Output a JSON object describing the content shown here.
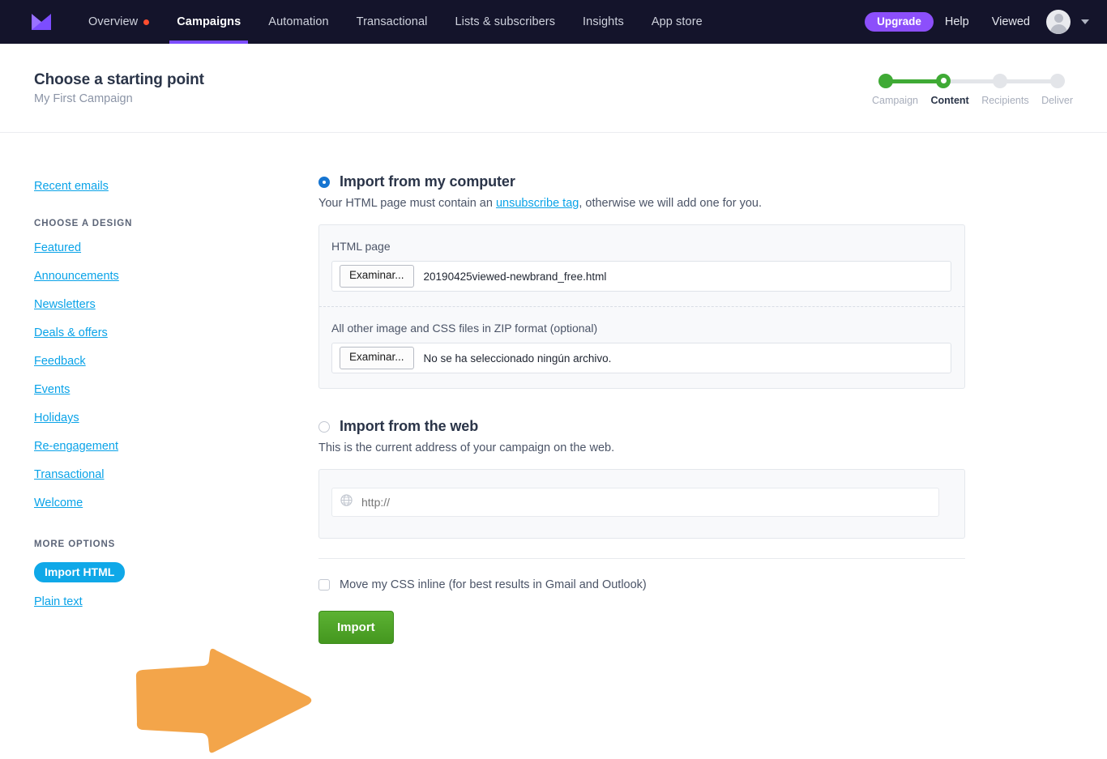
{
  "navbar": {
    "logo_name": "mailjet-logo",
    "links": [
      {
        "label": "Overview",
        "active": false,
        "dot": true
      },
      {
        "label": "Campaigns",
        "active": true,
        "dot": false
      },
      {
        "label": "Automation",
        "active": false,
        "dot": false
      },
      {
        "label": "Transactional",
        "active": false,
        "dot": false
      },
      {
        "label": "Lists & subscribers",
        "active": false,
        "dot": false
      },
      {
        "label": "Insights",
        "active": false,
        "dot": false
      },
      {
        "label": "App store",
        "active": false,
        "dot": false
      }
    ],
    "upgrade_label": "Upgrade",
    "help_label": "Help",
    "account_label": "Viewed",
    "accent_purple": "#7c4dff",
    "bar_color": "#14142b",
    "dot_color": "#ff4d2e"
  },
  "header": {
    "title": "Choose a starting point",
    "subtitle": "My First Campaign",
    "stepper": {
      "steps": [
        {
          "label": "Campaign",
          "state": "done"
        },
        {
          "label": "Content",
          "state": "current"
        },
        {
          "label": "Recipients",
          "state": "todo"
        },
        {
          "label": "Deliver",
          "state": "todo"
        }
      ],
      "done_color": "#3faa35",
      "todo_color": "#e3e5e9"
    }
  },
  "sidebar": {
    "recent_label": "Recent emails",
    "design_heading": "CHOOSE A DESIGN",
    "design_items": [
      "Featured",
      "Announcements",
      "Newsletters",
      "Deals & offers",
      "Feedback",
      "Events",
      "Holidays",
      "Re-engagement",
      "Transactional",
      "Welcome"
    ],
    "more_heading": "MORE OPTIONS",
    "more_items": [
      {
        "label": "Import HTML",
        "active": true
      },
      {
        "label": "Plain text",
        "active": false
      }
    ],
    "link_color": "#0aa3e8",
    "active_pill_color": "#0fa8e8"
  },
  "main": {
    "computer": {
      "title": "Import from my computer",
      "desc_before": "Your HTML page must contain an ",
      "desc_link": "unsubscribe tag",
      "desc_after": ", otherwise we will add one for you.",
      "selected": true,
      "html_field": {
        "label": "HTML page",
        "button": "Examinar...",
        "value": "20190425viewed-newbrand_free.html"
      },
      "zip_field": {
        "label": "All other image and CSS files in ZIP format (optional)",
        "button": "Examinar...",
        "value": "No se ha seleccionado ningún archivo."
      }
    },
    "web": {
      "title": "Import from the web",
      "desc": "This is the current address of your campaign on the web.",
      "selected": false,
      "url_placeholder": "http://",
      "url_value": "",
      "globe_icon": "globe-icon"
    },
    "inline_css": {
      "label": "Move my CSS inline (for best results in Gmail and Outlook)",
      "checked": false
    },
    "import_button": "Import",
    "import_button_color": "#4ba426"
  },
  "annotation": {
    "arrow_name": "orange-arrow-annotation",
    "color": "#f3a54a",
    "direction": "right"
  }
}
